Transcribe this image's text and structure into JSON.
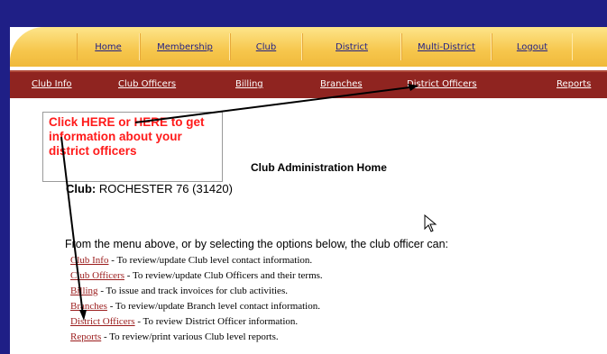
{
  "colors": {
    "frame": "#1f1f86",
    "nav_yellow": "#f6c64c",
    "nav_maroon": "#8f2420",
    "callout_text": "#ff1a1a",
    "link_red": "#9b1c1c"
  },
  "primary_nav": [
    "Home",
    "Membership",
    "Club",
    "District",
    "Multi-District",
    "Logout"
  ],
  "secondary_nav": [
    "Club Info",
    "Club Officers",
    "Billing",
    "Branches",
    "District Officers",
    "Reports"
  ],
  "callout": {
    "text": "Click HERE or HERE to get information about your district officers"
  },
  "main": {
    "title": "Club Administration Home",
    "club_label": "Club:",
    "club_value": "ROCHESTER 76 (31420)",
    "intro": "From the menu above, or by selecting the options below, the club officer can:",
    "options": [
      {
        "link": "Club Info",
        "desc": " - To review/update Club level contact information."
      },
      {
        "link": "Club Officers",
        "desc": " - To review/update Club Officers and their terms."
      },
      {
        "link": "Billing",
        "desc": " - To issue and track invoices for club activities."
      },
      {
        "link": "Branches",
        "desc": " - To review/update Branch level contact information."
      },
      {
        "link": "District Officers",
        "desc": " - To review District Officer information."
      },
      {
        "link": "Reports",
        "desc": " - To review/print various Club level reports."
      }
    ]
  },
  "icons": {
    "cursor": "mouse-pointer-icon"
  }
}
